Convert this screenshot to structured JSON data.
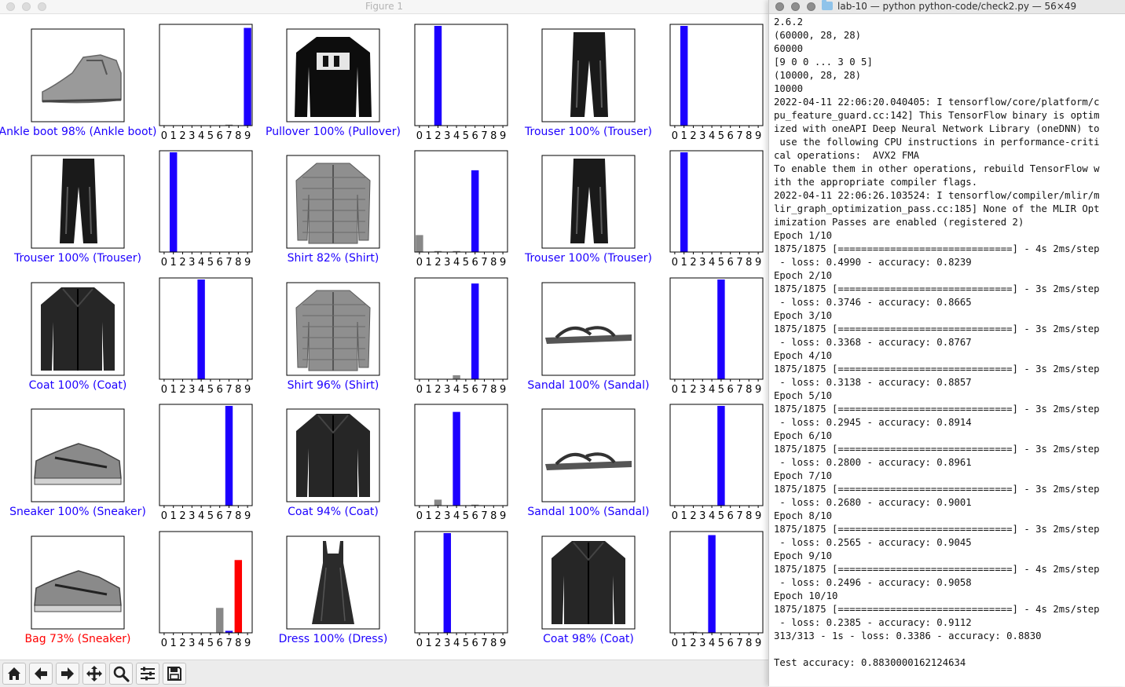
{
  "figure_window": {
    "title": "Figure 1",
    "tick_labels": [
      "0",
      "1",
      "2",
      "3",
      "4",
      "5",
      "6",
      "7",
      "8",
      "9"
    ],
    "colors": {
      "correct": "#1c00ff",
      "wrong": "#ff0000",
      "bar_default": "#888888"
    },
    "panels": [
      {
        "image": "ankle-boot",
        "label": "Ankle boot 98% (Ankle boot)",
        "correct": true,
        "predicted": 9,
        "true_label": 9,
        "probs": [
          0,
          0,
          0,
          0,
          0,
          0,
          0,
          0.01,
          0,
          0.98
        ]
      },
      {
        "image": "pullover",
        "label": "Pullover 100% (Pullover)",
        "correct": true,
        "predicted": 2,
        "true_label": 2,
        "probs": [
          0,
          0,
          1.0,
          0,
          0,
          0,
          0,
          0,
          0,
          0
        ]
      },
      {
        "image": "trouser",
        "label": "Trouser 100% (Trouser)",
        "correct": true,
        "predicted": 1,
        "true_label": 1,
        "probs": [
          0,
          1.0,
          0,
          0,
          0,
          0,
          0,
          0,
          0,
          0
        ]
      },
      {
        "image": "trouser",
        "label": "Trouser 100% (Trouser)",
        "correct": true,
        "predicted": 1,
        "true_label": 1,
        "probs": [
          0,
          1.0,
          0,
          0,
          0,
          0,
          0,
          0,
          0,
          0
        ]
      },
      {
        "image": "shirt",
        "label": "Shirt 82% (Shirt)",
        "correct": true,
        "predicted": 6,
        "true_label": 6,
        "probs": [
          0.17,
          0,
          0.01,
          0,
          0.01,
          0,
          0.82,
          0,
          0,
          0
        ]
      },
      {
        "image": "trouser",
        "label": "Trouser 100% (Trouser)",
        "correct": true,
        "predicted": 1,
        "true_label": 1,
        "probs": [
          0,
          1.0,
          0,
          0,
          0,
          0,
          0,
          0,
          0,
          0
        ]
      },
      {
        "image": "coat",
        "label": "Coat 100% (Coat)",
        "correct": true,
        "predicted": 4,
        "true_label": 4,
        "probs": [
          0,
          0,
          0,
          0,
          1.0,
          0,
          0,
          0,
          0,
          0
        ]
      },
      {
        "image": "shirt",
        "label": "Shirt 96% (Shirt)",
        "correct": true,
        "predicted": 6,
        "true_label": 6,
        "probs": [
          0,
          0,
          0,
          0,
          0.04,
          0,
          0.96,
          0,
          0,
          0
        ]
      },
      {
        "image": "sandal",
        "label": "Sandal 100% (Sandal)",
        "correct": true,
        "predicted": 5,
        "true_label": 5,
        "probs": [
          0,
          0,
          0,
          0,
          0,
          1.0,
          0,
          0,
          0,
          0
        ]
      },
      {
        "image": "sneaker",
        "label": "Sneaker 100% (Sneaker)",
        "correct": true,
        "predicted": 7,
        "true_label": 7,
        "probs": [
          0,
          0,
          0,
          0,
          0,
          0,
          0,
          1.0,
          0,
          0
        ]
      },
      {
        "image": "coat",
        "label": "Coat 94% (Coat)",
        "correct": true,
        "predicted": 4,
        "true_label": 4,
        "probs": [
          0,
          0,
          0.06,
          0,
          0.94,
          0,
          0.01,
          0,
          0,
          0
        ]
      },
      {
        "image": "sandal",
        "label": "Sandal 100% (Sandal)",
        "correct": true,
        "predicted": 5,
        "true_label": 5,
        "probs": [
          0,
          0,
          0,
          0,
          0,
          1.0,
          0,
          0,
          0,
          0
        ]
      },
      {
        "image": "sneaker",
        "label": "Bag 73% (Sneaker)",
        "correct": false,
        "predicted": 8,
        "true_label": 7,
        "probs": [
          0,
          0,
          0,
          0,
          0,
          0,
          0.25,
          0.02,
          0.73,
          0
        ]
      },
      {
        "image": "dress",
        "label": "Dress 100% (Dress)",
        "correct": true,
        "predicted": 3,
        "true_label": 3,
        "probs": [
          0,
          0,
          0,
          1.0,
          0,
          0,
          0,
          0,
          0,
          0
        ]
      },
      {
        "image": "coat",
        "label": "Coat 98% (Coat)",
        "correct": true,
        "predicted": 4,
        "true_label": 4,
        "probs": [
          0,
          0,
          0.01,
          0,
          0.98,
          0,
          0,
          0,
          0,
          0
        ]
      }
    ]
  },
  "toolbar": {
    "buttons": [
      {
        "icon": "home-icon"
      },
      {
        "icon": "back-arrow-icon"
      },
      {
        "icon": "forward-arrow-icon"
      },
      {
        "icon": "pan-move-icon"
      },
      {
        "icon": "zoom-magnifier-icon"
      },
      {
        "icon": "configure-subplots-icon"
      },
      {
        "icon": "save-floppy-icon"
      }
    ]
  },
  "terminal": {
    "title": "lab-10 — python python-code/check2.py — 56×49",
    "lines": [
      "2.6.2",
      "(60000, 28, 28)",
      "60000",
      "[9 0 0 ... 3 0 5]",
      "(10000, 28, 28)",
      "10000",
      "2022-04-11 22:06:20.040405: I tensorflow/core/platform/c",
      "pu_feature_guard.cc:142] This TensorFlow binary is optim",
      "ized with oneAPI Deep Neural Network Library (oneDNN) to",
      " use the following CPU instructions in performance-criti",
      "cal operations:  AVX2 FMA",
      "To enable them in other operations, rebuild TensorFlow w",
      "ith the appropriate compiler flags.",
      "2022-04-11 22:06:26.103524: I tensorflow/compiler/mlir/m",
      "lir_graph_optimization_pass.cc:185] None of the MLIR Opt",
      "imization Passes are enabled (registered 2)",
      "Epoch 1/10",
      "1875/1875 [==============================] - 4s 2ms/step",
      " - loss: 0.4990 - accuracy: 0.8239",
      "Epoch 2/10",
      "1875/1875 [==============================] - 3s 2ms/step",
      " - loss: 0.3746 - accuracy: 0.8665",
      "Epoch 3/10",
      "1875/1875 [==============================] - 3s 2ms/step",
      " - loss: 0.3368 - accuracy: 0.8767",
      "Epoch 4/10",
      "1875/1875 [==============================] - 3s 2ms/step",
      " - loss: 0.3138 - accuracy: 0.8857",
      "Epoch 5/10",
      "1875/1875 [==============================] - 3s 2ms/step",
      " - loss: 0.2945 - accuracy: 0.8914",
      "Epoch 6/10",
      "1875/1875 [==============================] - 3s 2ms/step",
      " - loss: 0.2800 - accuracy: 0.8961",
      "Epoch 7/10",
      "1875/1875 [==============================] - 3s 2ms/step",
      " - loss: 0.2680 - accuracy: 0.9001",
      "Epoch 8/10",
      "1875/1875 [==============================] - 3s 2ms/step",
      " - loss: 0.2565 - accuracy: 0.9045",
      "Epoch 9/10",
      "1875/1875 [==============================] - 4s 2ms/step",
      " - loss: 0.2496 - accuracy: 0.9058",
      "Epoch 10/10",
      "1875/1875 [==============================] - 4s 2ms/step",
      " - loss: 0.2385 - accuracy: 0.9112",
      "313/313 - 1s - loss: 0.3386 - accuracy: 0.8830",
      "",
      "Test accuracy: 0.8830000162124634"
    ]
  }
}
